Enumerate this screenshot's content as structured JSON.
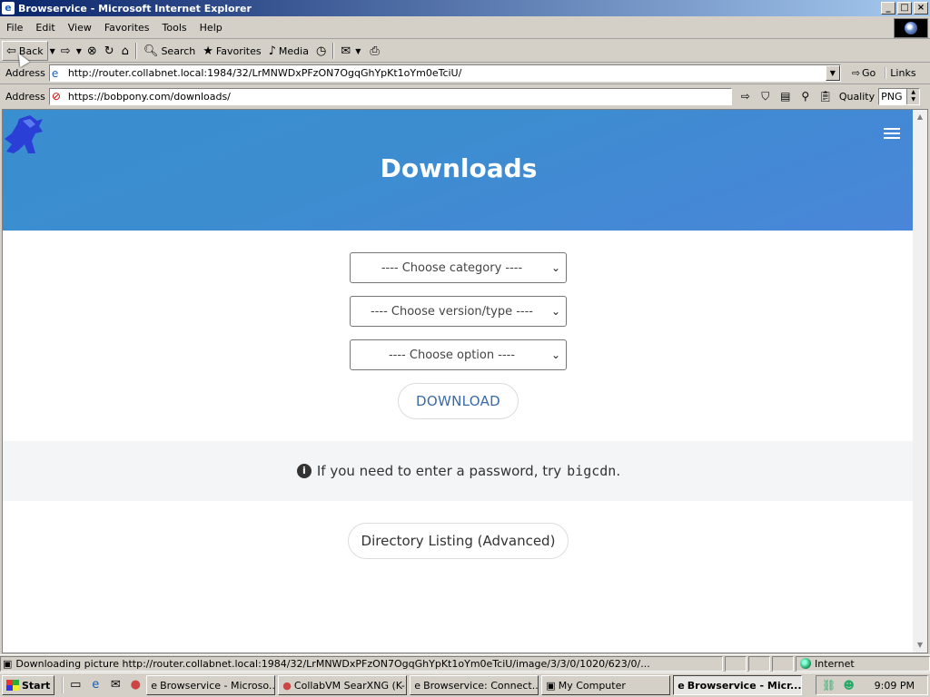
{
  "window": {
    "title": "Browservice - Microsoft Internet Explorer",
    "buttons": [
      "_",
      "□",
      "×"
    ]
  },
  "menu": {
    "items": [
      "File",
      "Edit",
      "View",
      "Favorites",
      "Tools",
      "Help"
    ]
  },
  "toolbar": {
    "back": "Back",
    "search": "Search",
    "favorites": "Favorites",
    "media": "Media"
  },
  "address_bar": {
    "label": "Address",
    "url": "http://router.collabnet.local:1984/32/LrMNWDxPFzON7OgqGhYpKt1oYm0eTciU/",
    "go": "Go",
    "links": "Links"
  },
  "inner_address_bar": {
    "label": "Address",
    "url": "https://bobpony.com/downloads/",
    "quality_label": "Quality",
    "quality_value": "PNG"
  },
  "page": {
    "title": "Downloads",
    "selects": [
      "---- Choose category ----",
      "---- Choose version/type ----",
      "---- Choose option ----"
    ],
    "download_button": "DOWNLOAD",
    "notice_text": "If you need to enter a password, try",
    "notice_code": "bigcdn",
    "notice_end": ".",
    "directory_button": "Directory Listing (Advanced)"
  },
  "status_bar": {
    "text": "Downloading picture http://router.collabnet.local:1984/32/LrMNWDxPFzON7OgqGhYpKt1oYm0eTciU/image/3/3/0/1020/623/0/...",
    "zone": "Internet"
  },
  "taskbar": {
    "start": "Start",
    "tasks": [
      "Browservice - Microso...",
      "CollabVM SearXNG (K-...",
      "Browservice: Connect...",
      "My Computer",
      "Browservice - Micr..."
    ],
    "clock": "9:09 PM"
  },
  "colors": {
    "hero_start": "#3a8fd0",
    "hero_end": "#4a86d9",
    "titlebar_start": "#0a246a",
    "titlebar_end": "#a6caf0",
    "link_blue": "#3a6aa8"
  }
}
